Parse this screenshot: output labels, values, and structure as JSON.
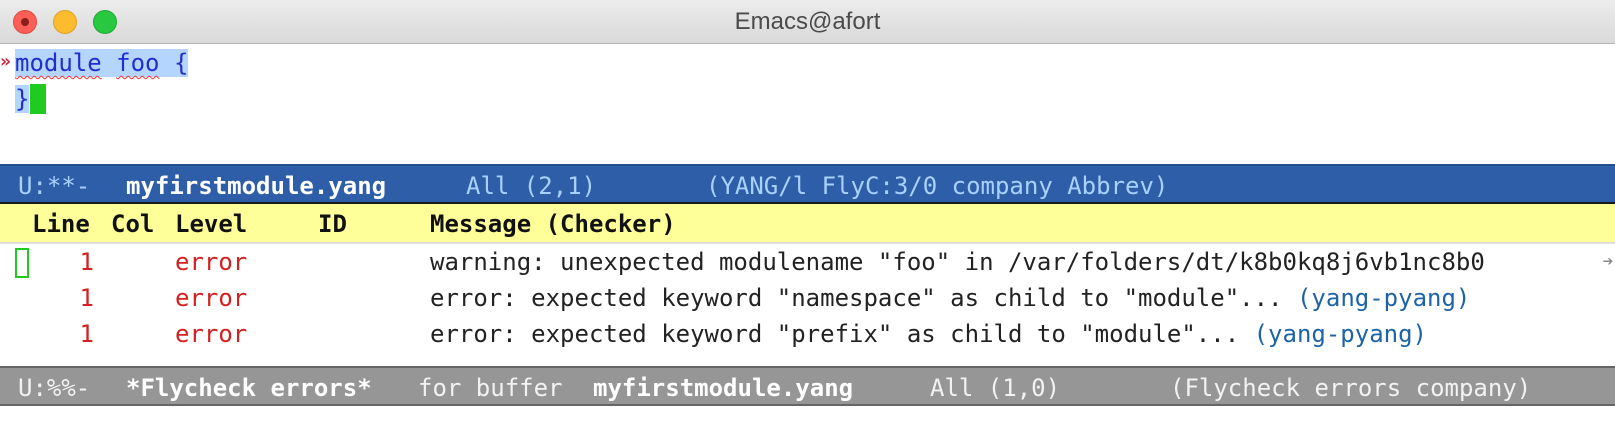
{
  "window": {
    "title": "Emacs@afort"
  },
  "editor": {
    "fringe_icon": "right-double-arrow-icon",
    "line1": {
      "keyword": "module",
      "space1": " ",
      "identifier": "foo",
      "space2": " ",
      "brace_open": "{"
    },
    "line2": {
      "brace_close": "}"
    }
  },
  "main_modeline": {
    "status": "U:**-",
    "buffer_name": "myfirstmodule.yang",
    "position": "All (2,1)",
    "modes": "(YANG/l FlyC:3/0 company Abbrev)"
  },
  "errors_header": {
    "columns": [
      "Line",
      "Col",
      "Level",
      "ID",
      "Message (Checker)"
    ]
  },
  "errors": [
    {
      "line": "1",
      "col": "",
      "level": "error",
      "id": "",
      "message": "warning: unexpected modulename \"foo\" in /var/folders/dt/k8b0kq8j6vb1nc8b0",
      "checker": ""
    },
    {
      "line": "1",
      "col": "",
      "level": "error",
      "id": "",
      "message": "error: expected keyword \"namespace\" as child to \"module\"...",
      "checker": "(yang-pyang)"
    },
    {
      "line": "1",
      "col": "",
      "level": "error",
      "id": "",
      "message": "error: expected keyword \"prefix\" as child to \"module\"...",
      "checker": "(yang-pyang)"
    }
  ],
  "errors_modeline": {
    "status": "U:%%-",
    "buffer_name": "*Flycheck errors*",
    "for_text": "for buffer",
    "target_buffer": "myfirstmodule.yang",
    "position": "All (1,0)",
    "modes": "(Flycheck errors company)"
  },
  "colors": {
    "active_modeline_bg": "#2f5ea8",
    "inactive_modeline_bg": "#969696",
    "header_bg": "#ffff9a",
    "cursor": "#1fcb1f",
    "region": "#b4d5fe",
    "error_red": "#d32020",
    "checker_blue": "#1d63a8"
  }
}
